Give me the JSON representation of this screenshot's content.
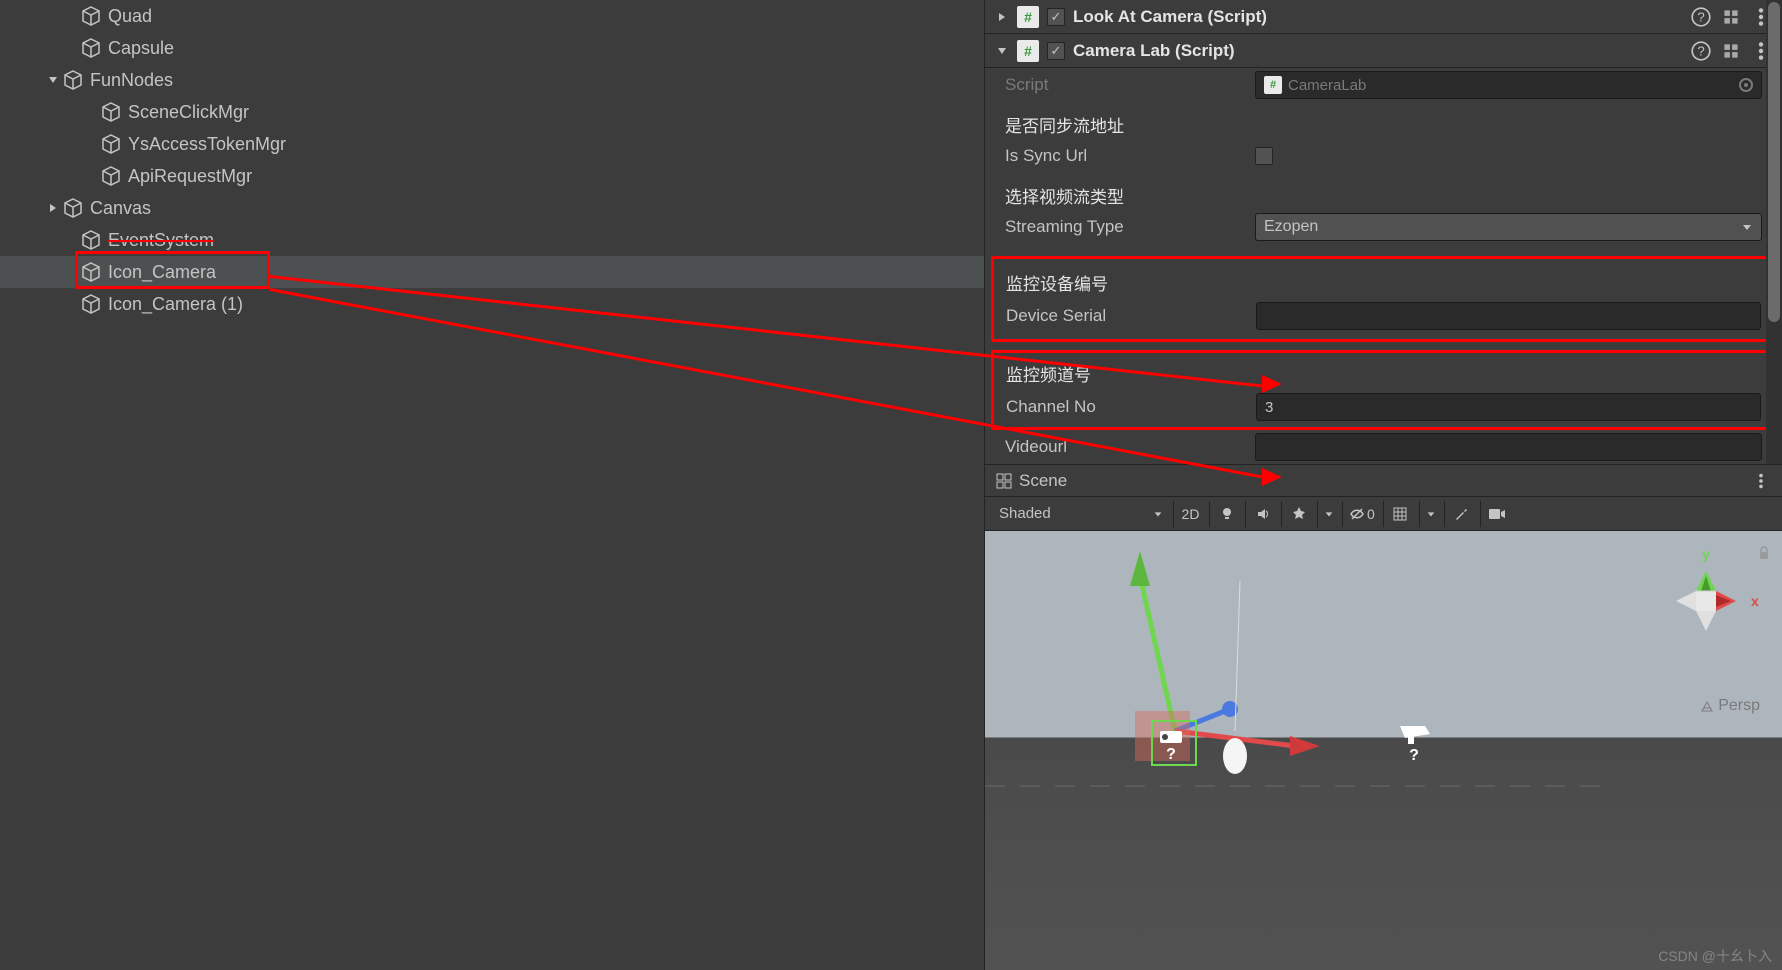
{
  "hierarchy": {
    "items": [
      {
        "label": "Quad",
        "indent": 80
      },
      {
        "label": "Capsule",
        "indent": 80
      },
      {
        "label": "FunNodes",
        "indent": 60,
        "expanded": true
      },
      {
        "label": "SceneClickMgr",
        "indent": 100
      },
      {
        "label": "YsAccessTokenMgr",
        "indent": 100
      },
      {
        "label": "ApiRequestMgr",
        "indent": 100
      },
      {
        "label": "Canvas",
        "indent": 60,
        "collapsed": true
      },
      {
        "label": "EventSystem",
        "indent": 80
      },
      {
        "label": "Icon_Camera",
        "indent": 80,
        "selected": true
      },
      {
        "label": "Icon_Camera (1)",
        "indent": 80
      }
    ]
  },
  "inspector": {
    "lookAt": {
      "title": "Look At Camera (Script)"
    },
    "cameraLab": {
      "title": "Camera Lab (Script)",
      "scriptLabel": "Script",
      "scriptValue": "CameraLab",
      "syncHeader": "是否同步流地址",
      "syncLabel": "Is Sync Url",
      "streamHeader": "选择视频流类型",
      "streamLabel": "Streaming Type",
      "streamValue": "Ezopen",
      "deviceHeader": "监控设备编号",
      "deviceLabel": "Device Serial",
      "deviceValue": "",
      "channelHeader": "监控频道号",
      "channelLabel": "Channel No",
      "channelValue": "3",
      "videoLabel": "Videourl",
      "videoValue": ""
    }
  },
  "scene": {
    "title": "Scene",
    "shading": "Shaded",
    "btn2D": "2D",
    "hideCount": "0",
    "persp": "Persp",
    "axisX": "x",
    "axisY": "y"
  },
  "watermark": "CSDN @十幺卜入"
}
